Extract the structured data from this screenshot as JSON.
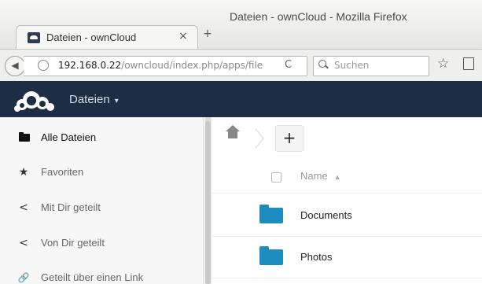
{
  "window": {
    "title": "Dateien - ownCloud - Mozilla Firefox"
  },
  "tab": {
    "label": "Dateien - ownCloud",
    "close": "×",
    "new_tab": "+"
  },
  "navbar": {
    "url_host": "192.168.0.22",
    "url_path": "/owncloud/index.php/apps/file",
    "reload": "C",
    "search_placeholder": "Suchen",
    "star": "☆"
  },
  "header": {
    "app_name": "Dateien",
    "caret": "▾"
  },
  "sidebar": {
    "items": [
      {
        "label": "Alle Dateien",
        "icon": "folder-icon"
      },
      {
        "label": "Favoriten",
        "icon": "star-icon",
        "glyph": "★"
      },
      {
        "label": "Mit Dir geteilt",
        "icon": "share-icon",
        "glyph": "<"
      },
      {
        "label": "Von Dir geteilt",
        "icon": "share-icon",
        "glyph": "<"
      },
      {
        "label": "Geteilt über einen Link",
        "icon": "link-icon",
        "glyph": "🔗"
      }
    ]
  },
  "main": {
    "new_button": "+",
    "column_name": "Name",
    "sort_indicator": "▲",
    "files": [
      {
        "name": "Documents"
      },
      {
        "name": "Photos"
      }
    ]
  },
  "colors": {
    "header_bg": "#1d2d44",
    "folder": "#1d8cbe"
  }
}
